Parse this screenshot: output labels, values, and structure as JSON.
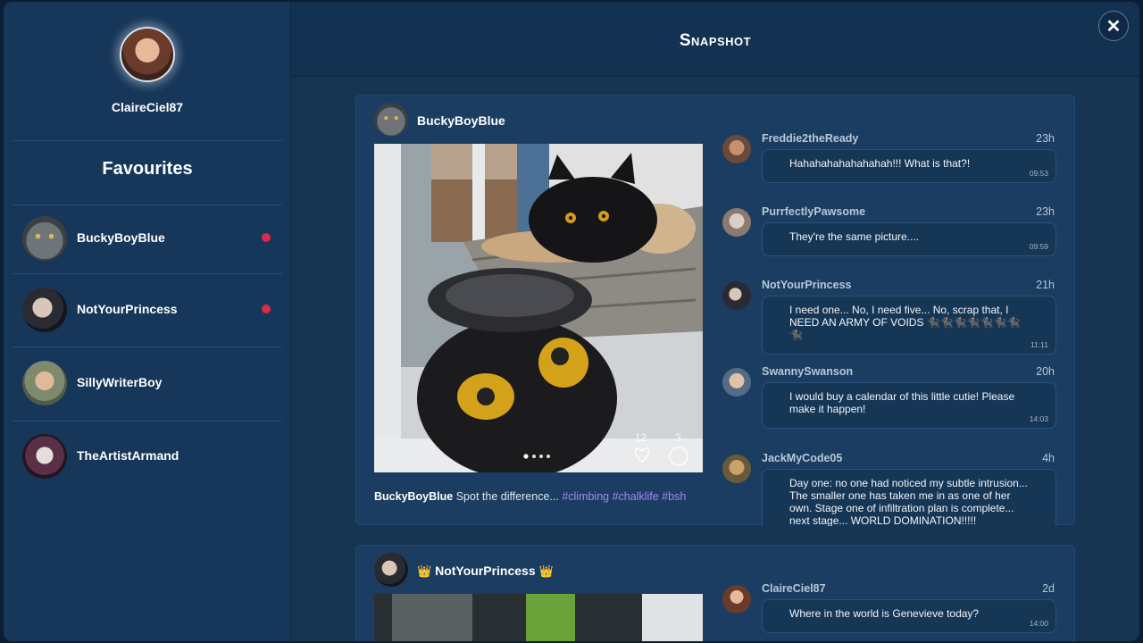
{
  "app": {
    "title": "Snapshot",
    "close_label": "✕"
  },
  "profile": {
    "username": "ClaireCiel87"
  },
  "favourites": {
    "title": "Favourites",
    "items": [
      {
        "name": "BuckyBoyBlue",
        "unread": true
      },
      {
        "name": "NotYourPrincess",
        "unread": true
      },
      {
        "name": "SillyWriterBoy",
        "unread": false
      },
      {
        "name": "TheArtistArmand",
        "unread": false
      }
    ]
  },
  "posts": [
    {
      "author": "BuckyBoyBlue",
      "caption_user": "BuckyBoyBlue",
      "caption_text": " Spot the difference... ",
      "tags": "#climbing #chalklife #bsh",
      "likes": "12",
      "comments_count": "3",
      "comments": [
        {
          "user": "Freddie2theReady",
          "age": "23h",
          "text": "Hahahahahahahahah!!! What is that?!",
          "time": "09:53"
        },
        {
          "user": "PurrfectlyPawsome",
          "age": "23h",
          "text": "They're the same picture....",
          "time": "09:59"
        },
        {
          "user": "NotYourPrincess",
          "age": "21h",
          "text": "I need one... No, I need five... No, scrap that, I NEED AN ARMY OF VOIDS 🐈‍⬛🐈‍⬛🐈‍⬛🐈‍⬛🐈‍⬛🐈‍⬛🐈‍⬛🐈‍⬛",
          "time": "11:11"
        },
        {
          "user": "SwannySwanson",
          "age": "20h",
          "text": "I would buy a calendar of this little cutie! Please make it happen!",
          "time": "14:03"
        },
        {
          "user": "JackMyCode05",
          "age": "4h",
          "text": "Day one: no one had noticed my subtle intrusion... The smaller one has taken me in as one of her own. Stage one of infiltration plan is complete... next stage... WORLD DOMINATION!!!!!",
          "time": ""
        }
      ]
    },
    {
      "author": "NotYourPrincess",
      "crown": "👑",
      "comments": [
        {
          "user": "ClaireCiel87",
          "age": "2d",
          "text": "Where in the world is Genevieve today?",
          "time": "14:00"
        }
      ]
    }
  ]
}
